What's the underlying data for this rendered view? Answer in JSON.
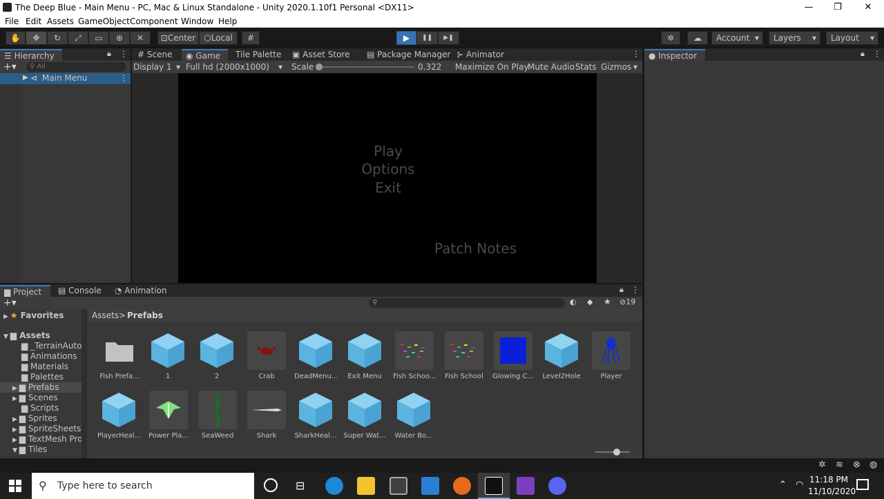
{
  "window": {
    "title": "The Deep Blue - Main Menu - PC, Mac & Linux Standalone - Unity 2020.1.10f1 Personal <DX11>",
    "min": "—",
    "max": "❐",
    "close": "✕"
  },
  "menu": [
    "File",
    "Edit",
    "Assets",
    "GameObject",
    "Component",
    "Window",
    "Help"
  ],
  "toolbar": {
    "center": "Center",
    "local": "Local",
    "account": "Account",
    "layers": "Layers",
    "layout": "Layout",
    "play": "▶",
    "pause": "❚❚",
    "step": "▶❚"
  },
  "hierarchy": {
    "tab": "Hierarchy",
    "search_placeholder": "All",
    "root": "Main Menu"
  },
  "center_tabs": [
    "Scene",
    "Game",
    "Tile Palette",
    "Asset Store",
    "Package Manager",
    "Animator"
  ],
  "game": {
    "display": "Display 1",
    "resolution": "Full hd (2000x1000)",
    "scale_label": "Scale",
    "scale_value": "0.322x",
    "maximize": "Maximize On Play",
    "mute": "Mute Audio",
    "stats": "Stats",
    "gizmos": "Gizmos",
    "menu_play": "Play",
    "menu_options": "Options",
    "menu_exit": "Exit",
    "patch_notes": "Patch Notes"
  },
  "inspector": {
    "tab": "Inspector"
  },
  "bottom_tabs": [
    "Project",
    "Console",
    "Animation"
  ],
  "project": {
    "hidden_count": "19",
    "breadcrumb_root": "Assets",
    "breadcrumb_sep": ">",
    "breadcrumb_current": "Prefabs",
    "favorites": "Favorites",
    "assets_root": "Assets",
    "folders": [
      "_TerrainAutol",
      "Animations",
      "Materials",
      "Palettes",
      "Prefabs",
      "Scenes",
      "Scripts",
      "Sprites",
      "SpriteSheets",
      "TextMesh Pro",
      "Tiles"
    ],
    "items_row1": [
      "Fish Prefa...",
      "1",
      "2",
      "Crab",
      "DeadMenu...",
      "Exit Menu",
      "Fish Schoo...",
      "Fish School",
      "Glowing C...",
      "Level2Hole",
      "Player"
    ],
    "items_row2": [
      "PlayerHeal...",
      "Power Pla...",
      "SeaWeed",
      "Shark",
      "SharkHeal...",
      "Super Wat...",
      "Water Bo..."
    ]
  },
  "taskbar": {
    "search": "Type here to search",
    "time": "11:18 PM",
    "date": "11/10/2020"
  },
  "colors": {
    "accent": "#3a79bb",
    "cube": "#6cc0e8",
    "glow": "#0a20d8"
  }
}
